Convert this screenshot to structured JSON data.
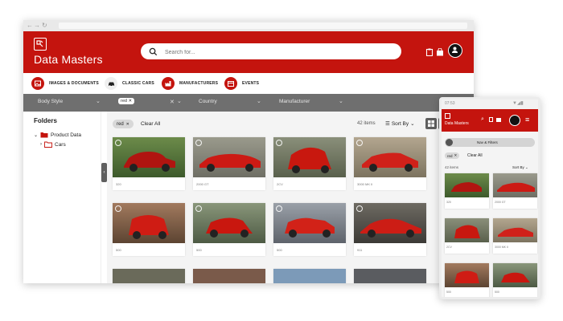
{
  "brand": {
    "name": "Data Masters",
    "accent": "#c4140e"
  },
  "search": {
    "placeholder": "Search for..."
  },
  "header_icons": [
    "clipboard-icon",
    "bag-icon",
    "user-icon"
  ],
  "categories": [
    {
      "label": "IMAGES & DOCUMENTS",
      "icon": "image-icon"
    },
    {
      "label": "CLASSIC CARS",
      "icon": "car-icon"
    },
    {
      "label": "MANUFACTURERS",
      "icon": "factory-icon"
    },
    {
      "label": "EVENTS",
      "icon": "calendar-icon"
    }
  ],
  "filters": {
    "body_style": "Body Style",
    "color_chip": "red",
    "country": "Country",
    "manufacturer": "Manufacturer"
  },
  "sidebar": {
    "title": "Folders",
    "tree": [
      {
        "label": "Product Data",
        "expanded": true
      },
      {
        "label": "Cars",
        "expanded": false
      }
    ]
  },
  "toolbar": {
    "active_chip": "red",
    "clear_all": "Clear All",
    "items_count": "42 items",
    "sort_label": "Sort By"
  },
  "cards": [
    {
      "caption": "320"
    },
    {
      "caption": "2000 GT"
    },
    {
      "caption": "2CV"
    },
    {
      "caption": "3000 MK II"
    },
    {
      "caption": "500"
    },
    {
      "caption": "500"
    },
    {
      "caption": "500"
    },
    {
      "caption": "911"
    }
  ],
  "phone": {
    "status_time": "07:53",
    "brand": "Data Masters",
    "nav_filters": "Nav & Filters",
    "chip": "red",
    "clear_all": "Clear All",
    "items_count": "42 items",
    "sort_label": "Sort By",
    "cards": [
      {
        "caption": "320"
      },
      {
        "caption": "2000 GT"
      },
      {
        "caption": "2CV"
      },
      {
        "caption": "3000 MK II"
      },
      {
        "caption": "500"
      },
      {
        "caption": "500"
      }
    ]
  }
}
